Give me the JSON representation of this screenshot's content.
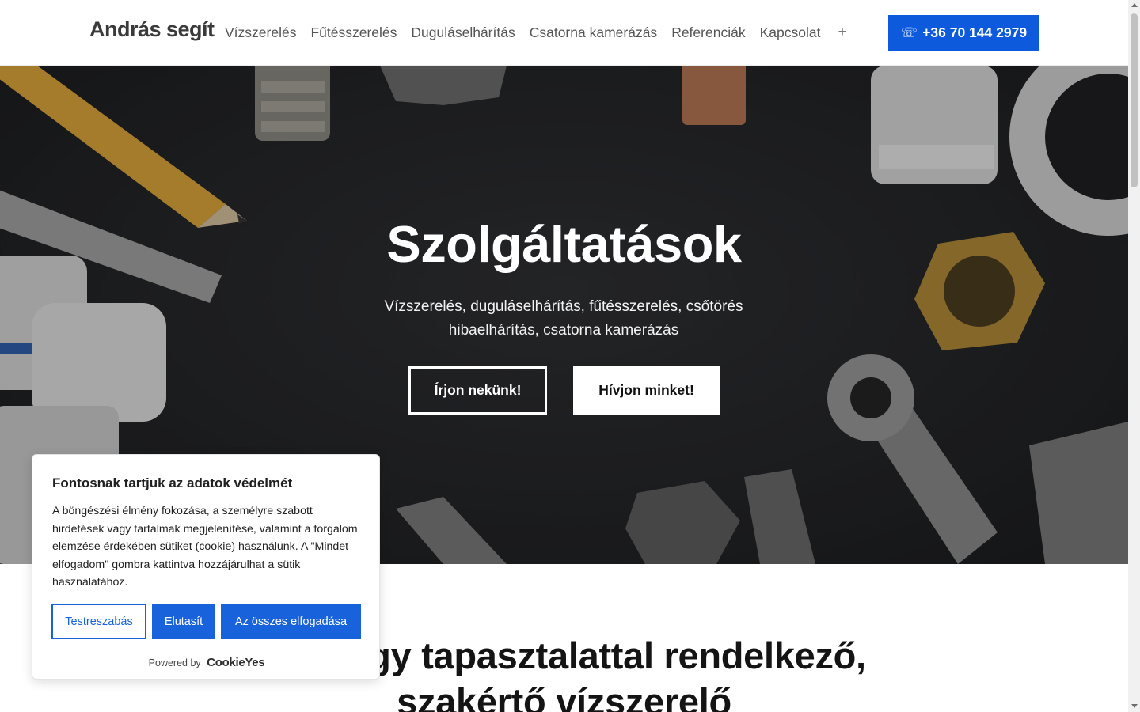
{
  "header": {
    "logo": "András segít",
    "nav": [
      "Vízszerelés",
      "Fűtésszerelés",
      "Duguláselhárítás",
      "Csatorna kamerázás",
      "Referenciák",
      "Kapcsolat"
    ],
    "more_symbol": "+",
    "phone_icon": "☏",
    "phone": "+36 70 144 2979"
  },
  "hero": {
    "title": "Szolgáltatások",
    "subtitle": "Vízszerelés, duguláselhárítás, fűtésszerelés, csőtörés hibaelhárítás, csatorna kamerázás",
    "btn_write": "Írjon nekünk!",
    "btn_call": "Hívjon minket!"
  },
  "section": {
    "heading_line1": "ok, nagy tapasztalattal rendelkező,",
    "heading_line2": "szakértő vízszerelő"
  },
  "cookie": {
    "title": "Fontosnak tartjuk az adatok védelmét",
    "text": "A böngészési élmény fokozása, a személyre szabott hirdetések vagy tartalmak megjelenítése, valamint a forgalom elemzése érdekében sütiket (cookie) használunk. A \"Mindet elfogadom\" gombra kattintva hozzájárulhat a sütik használatához.",
    "customize": "Testreszabás",
    "reject": "Elutasít",
    "accept_all": "Az összes elfogadása",
    "powered_by": "Powered by",
    "brand": "CookieYes"
  },
  "colors": {
    "accent": "#0d5bdc",
    "cookie_accent": "#1863dc",
    "hero_bg": "#222326"
  },
  "icons": {
    "phone": "phone-icon",
    "more": "plus-icon"
  }
}
